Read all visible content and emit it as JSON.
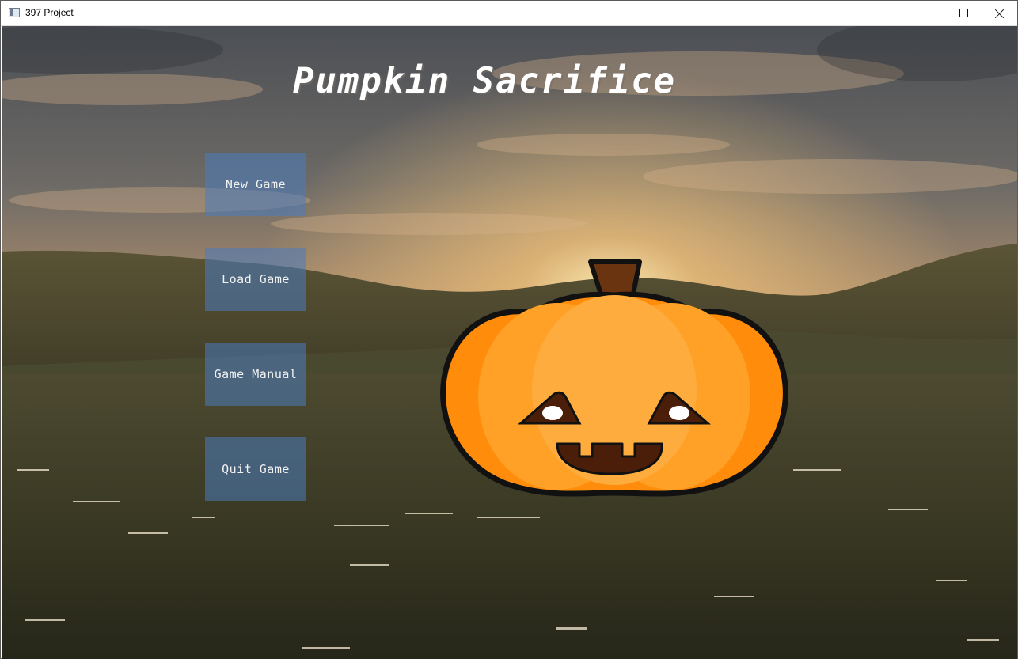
{
  "window": {
    "title": "397 Project",
    "app_icon": "window-app-icon",
    "controls": [
      "minimize-icon",
      "maximize-icon",
      "close-icon"
    ]
  },
  "game": {
    "title": "Pumpkin Sacrifice"
  },
  "menu": {
    "new_game": "New Game",
    "load_game": "Load Game",
    "game_manual": "Game Manual",
    "quit_game": "Quit Game"
  },
  "colors": {
    "button_bg": "#4a7cbe",
    "pumpkin": "#ff9a1f",
    "pumpkin_stem": "#6b3410",
    "pumpkin_face": "#4a1e08"
  }
}
